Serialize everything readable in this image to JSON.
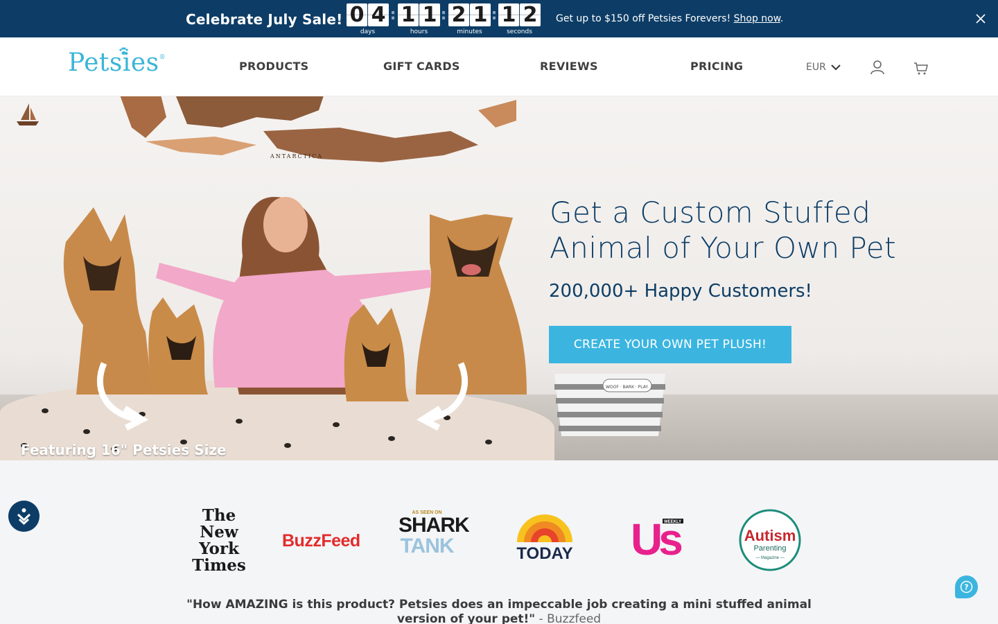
{
  "promo": {
    "title": "Celebrate July Sale!",
    "countdown": [
      {
        "digits": [
          "0",
          "4"
        ],
        "label": "days"
      },
      {
        "digits": [
          "1",
          "1"
        ],
        "label": "hours"
      },
      {
        "digits": [
          "2",
          "1"
        ],
        "label": "minutes"
      },
      {
        "digits": [
          "1",
          "2"
        ],
        "label": "seconds"
      }
    ],
    "separator": ":",
    "text": "Get up to $150 off Petsies Forevers! ",
    "link": "Shop now",
    "after_link": ".",
    "close_icon": "close-icon"
  },
  "header": {
    "logo": "Petsies",
    "nav": [
      "PRODUCTS",
      "GIFT CARDS",
      "REVIEWS",
      "PRICING"
    ],
    "currency": "EUR",
    "icons": [
      "chevron-down-icon",
      "user-icon",
      "cart-icon"
    ]
  },
  "hero": {
    "title": "Get a Custom Stuffed Animal of Your Own Pet",
    "subtitle": "200,000+ Happy Customers!",
    "cta": "CREATE YOUR OWN PET PLUSH!",
    "caption": "Featuring 16\" Petsies Size",
    "map_label": "ANTARCTICA",
    "basket_label": "WOOF · BARK · PLAY"
  },
  "press": {
    "nyt": "The New York Times",
    "nyt_lines": [
      "The",
      "New York",
      "Times"
    ],
    "buzzfeed": "BuzzFeed",
    "shark_seen": "AS SEEN ON",
    "shark_1": "SHARK",
    "shark_2": "TANK",
    "today": "TODAY",
    "us": "Us",
    "us_weekly": "WEEKLY",
    "autism_1": "Autism",
    "autism_2": "Parenting",
    "autism_3": "— Magazine —"
  },
  "quote": {
    "text": "\"How AMAZING is this product? Petsies does an impeccable job creating a mini stuffed animal version of your pet!\"",
    "source": " - Buzzfeed"
  },
  "colors": {
    "navy": "#0d3d66",
    "brand_blue": "#3bb5e0"
  }
}
